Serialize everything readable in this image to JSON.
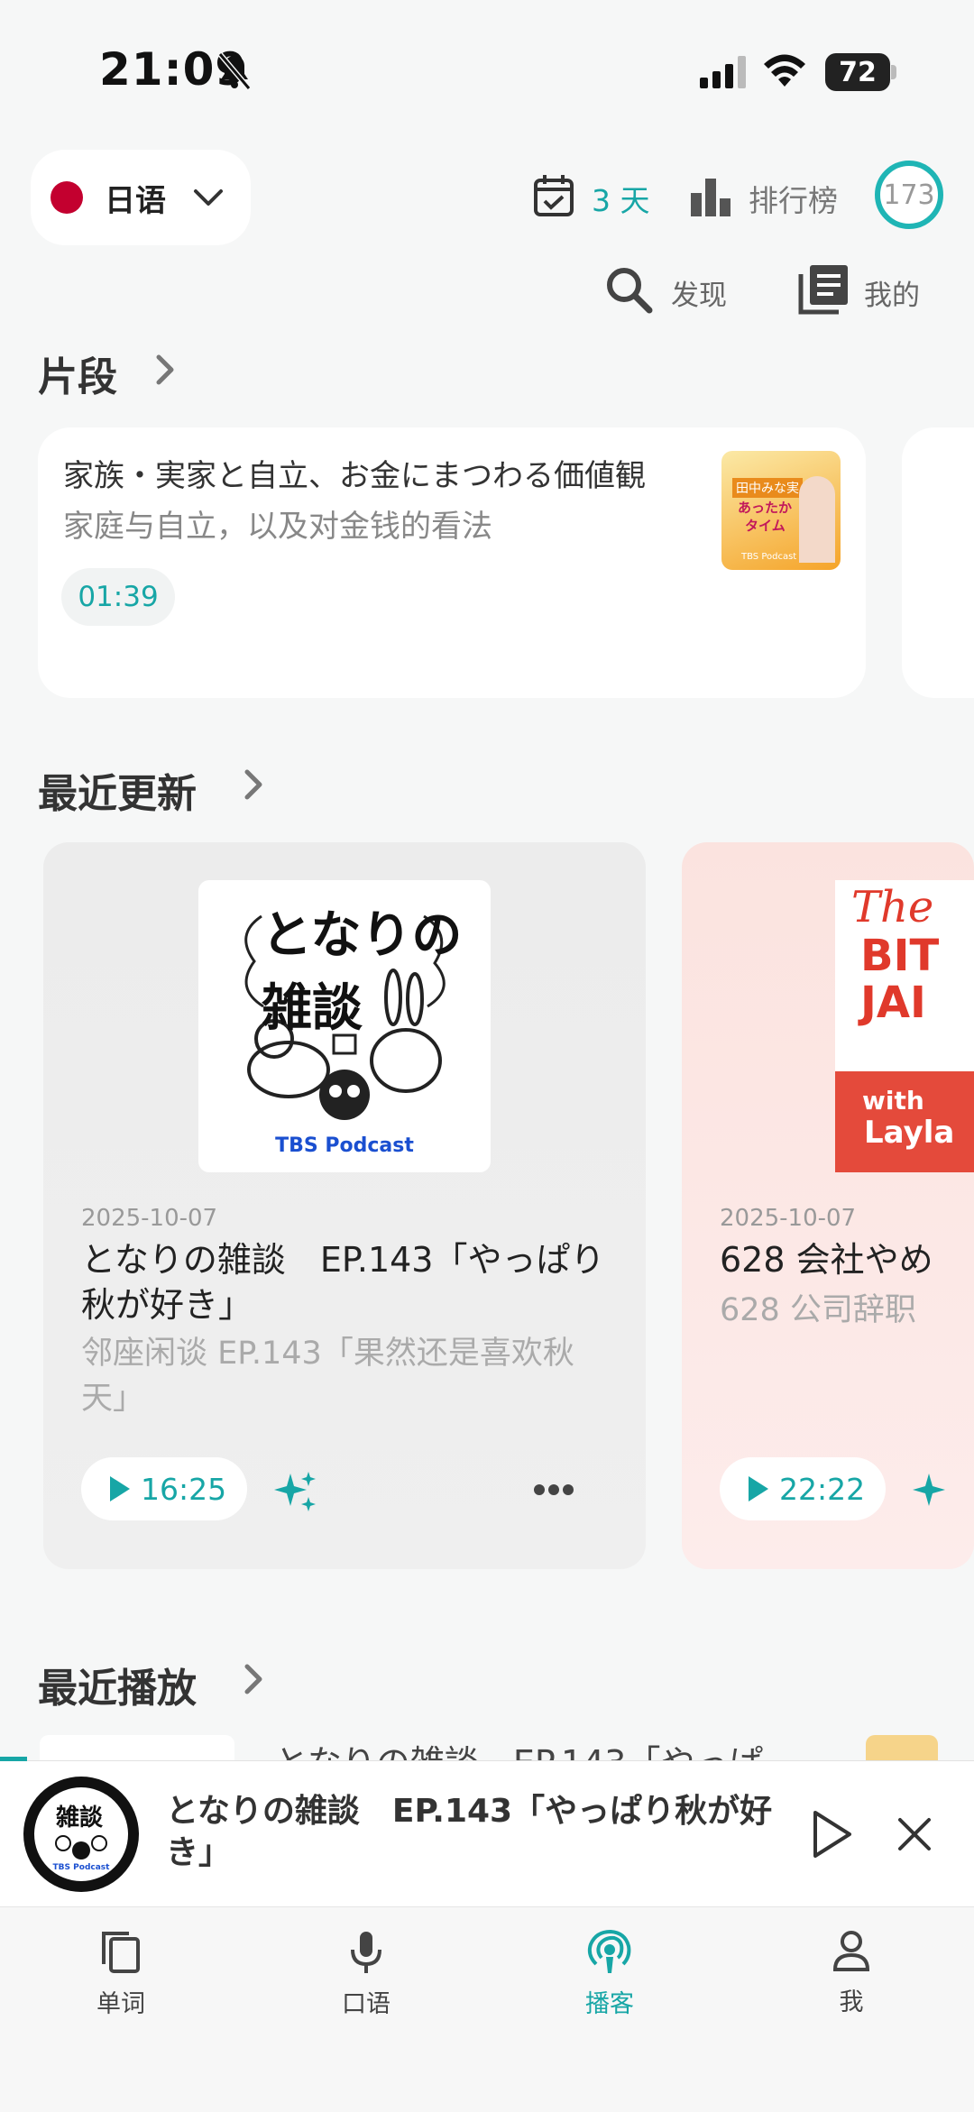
{
  "status_bar": {
    "time": "21:09",
    "battery": "72"
  },
  "header": {
    "language": "日语",
    "streak": "3 天",
    "ranking": "排行榜",
    "badge_count": "173",
    "discover": "发现",
    "mine": "我的"
  },
  "clips": {
    "title": "片段",
    "items": [
      {
        "title": "家族・実家と自立、お金にまつわる価値観",
        "subtitle": "家庭与自立，以及对金钱的看法",
        "duration": "01:39",
        "thumb_text_1": "田中みな実",
        "thumb_text_2": "あったか",
        "thumb_text_3": "タイム",
        "thumb_brand": "TBS Podcast"
      }
    ]
  },
  "recent_updates": {
    "title": "最近更新",
    "items": [
      {
        "date": "2025-10-07",
        "title": "となりの雑談　EP.143「やっぱり秋が好き」",
        "subtitle": "邻座闲谈 EP.143「果然还是喜欢秋天」",
        "duration": "16:25",
        "cover_title": "となりの雑談",
        "cover_brand": "TBS Podcast"
      },
      {
        "date": "2025-10-07",
        "title": "628 会社やめ",
        "subtitle": "628 公司辞职",
        "duration": "22:22",
        "cover_line1": "The",
        "cover_line2": "BIT",
        "cover_line3": "JAI",
        "cover_with": "with",
        "cover_name": "Layla"
      }
    ]
  },
  "recently_played": {
    "title": "最近播放",
    "first_item_partial": "となりの雑談　EP.143「やっぱ"
  },
  "mini_player": {
    "title": "となりの雑談　EP.143「やっぱり秋が好き」",
    "art_brand": "TBS Podcast"
  },
  "bottom_nav": [
    {
      "label": "单词"
    },
    {
      "label": "口语"
    },
    {
      "label": "播客"
    },
    {
      "label": "我"
    }
  ],
  "colors": {
    "accent": "#17a6a6",
    "flag": "#c3002f"
  }
}
